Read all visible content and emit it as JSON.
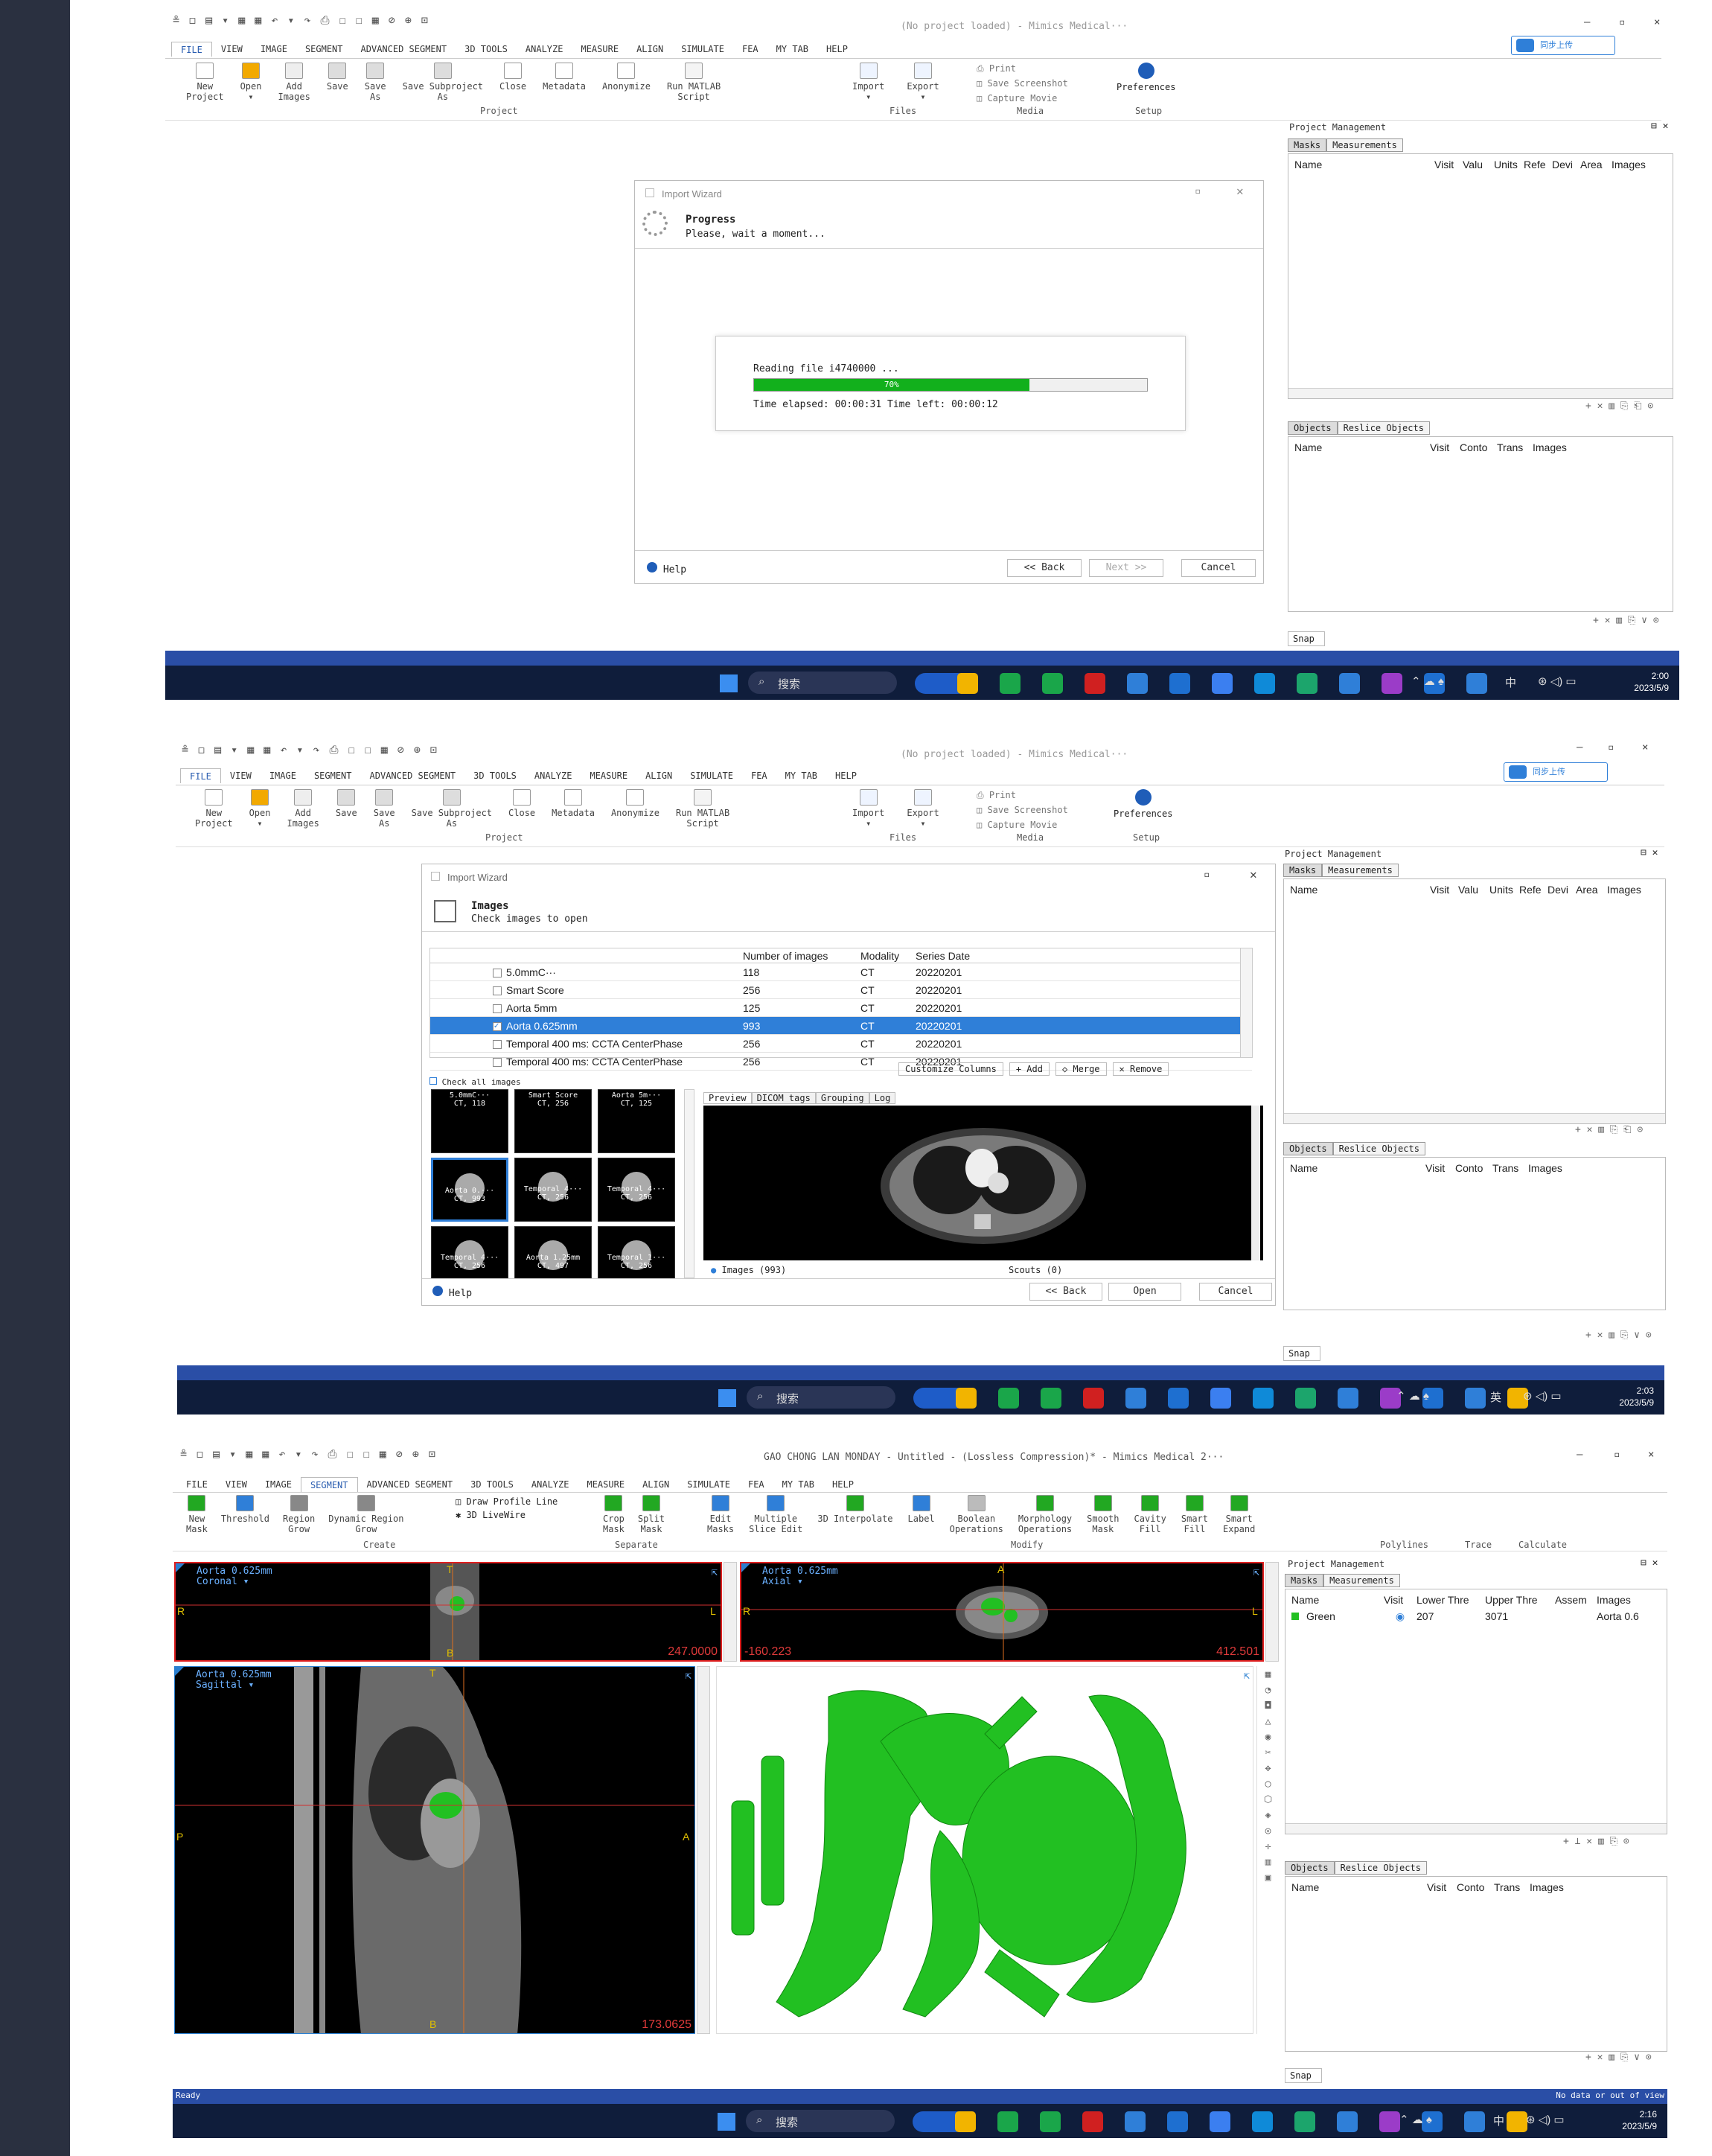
{
  "colors": {
    "accent_blue": "#2a5db0",
    "selection": "#2f7fd8",
    "progress_green": "#12b01c",
    "mask_green": "#22c022",
    "taskbar": "#0f1d3b",
    "red_border": "#e02020"
  },
  "app": {
    "quick_access": "≗ ◻ ▤ ▾ ▦ ▦ ↶ ▾ ↷ ⎙ ☐ ☐ ▦ ⊘ ⊕ ⊡",
    "title_empty": "(No project loaded) - Mimics Medical···",
    "title_3": "GAO CHONG LAN MONDAY - Untitled -  (Lossless Compression)* - Mimics Medical 2···",
    "win_controls": [
      "–",
      "▫",
      "×"
    ],
    "cloud_btn": "同步上传",
    "menu_tabs": [
      "FILE",
      "VIEW",
      "IMAGE",
      "SEGMENT",
      "ADVANCED SEGMENT",
      "3D TOOLS",
      "ANALYZE",
      "MEASURE",
      "ALIGN",
      "SIMULATE",
      "FEA",
      "MY TAB",
      "HELP"
    ],
    "file_ribbon": {
      "project": [
        {
          "l": "New\nProject",
          "icon": "new-project-icon"
        },
        {
          "l": "Open\n▾",
          "icon": "open-folder-icon"
        },
        {
          "l": "Add\nImages",
          "icon": "add-images-icon"
        },
        {
          "l": "Save",
          "icon": "save-icon"
        },
        {
          "l": "Save\nAs",
          "icon": "save-as-icon"
        },
        {
          "l": "Save Subproject\nAs",
          "icon": "save-subproject-icon"
        },
        {
          "l": "Close",
          "icon": "close-project-icon"
        },
        {
          "l": "Metadata",
          "icon": "metadata-icon"
        },
        {
          "l": "Anonymize",
          "icon": "anonymize-icon"
        },
        {
          "l": "Run MATLAB\nScript",
          "icon": "matlab-icon"
        }
      ],
      "project_label": "Project",
      "files": [
        {
          "l": "Import\n▾",
          "icon": "import-icon"
        },
        {
          "l": "Export\n▾",
          "icon": "export-icon"
        }
      ],
      "files_label": "Files",
      "media": [
        "Print",
        "Save Screenshot",
        "Capture Movie"
      ],
      "media_label": "Media",
      "prefs": "Preferences",
      "setup_label": "Setup"
    },
    "segment_ribbon": {
      "create": [
        {
          "l": "New\nMask",
          "icon": "new-mask-icon"
        },
        {
          "l": "Threshold",
          "icon": "threshold-icon"
        },
        {
          "l": "Region\nGrow",
          "icon": "region-grow-icon"
        },
        {
          "l": "Dynamic Region\nGrow",
          "icon": "dynamic-region-grow-icon"
        }
      ],
      "create_small": [
        "Draw Profile Line",
        "3D LiveWire"
      ],
      "create_label": "Create",
      "separate": [
        {
          "l": "Crop\nMask",
          "icon": "crop-mask-icon"
        },
        {
          "l": "Split\nMask",
          "icon": "split-mask-icon"
        }
      ],
      "separate_label": "Separate",
      "modify": [
        {
          "l": "Edit\nMasks",
          "icon": "edit-masks-icon"
        },
        {
          "l": "Multiple\nSlice Edit",
          "icon": "multiple-slice-edit-icon"
        },
        {
          "l": "3D Interpolate",
          "icon": "interpolate-icon"
        },
        {
          "l": "Label",
          "icon": "label-icon"
        },
        {
          "l": "Boolean\nOperations",
          "icon": "boolean-icon"
        },
        {
          "l": "Morphology\nOperations",
          "icon": "morphology-icon"
        },
        {
          "l": "Smooth\nMask",
          "icon": "smooth-mask-icon"
        },
        {
          "l": "Cavity\nFill",
          "icon": "cavity-fill-icon"
        },
        {
          "l": "Smart\nFill",
          "icon": "smart-fill-icon"
        },
        {
          "l": "Smart\nExpand",
          "icon": "smart-expand-icon"
        }
      ],
      "modify_label": "Modify",
      "polylines_label": "Polylines",
      "trace_label": "Trace",
      "calculate_label": "Calculate"
    },
    "pm": {
      "title": "Project Management",
      "tabs": [
        "Masks",
        "Measurements"
      ],
      "cols": [
        "Name",
        "Visit",
        "Valu",
        "Units",
        "Refe",
        "Devi",
        "Area",
        "Images"
      ],
      "mask_cols": [
        "Name",
        "Visit",
        "Lower Thre",
        "Upper Thre",
        "Assem",
        "Images"
      ],
      "mask_row": {
        "name": "Green",
        "eye": "◉",
        "lower": "207",
        "upper": "3071",
        "image": "Aorta 0.6"
      },
      "toolbar": "+ ✕ ▥ ⎘ ⎗ ⊙",
      "toolbar2": "+ ⊥ ✕ ▥ ⎘ ⊙"
    },
    "objects": {
      "tabs": [
        "Objects",
        "Reslice Objects"
      ],
      "cols": [
        "Name",
        "Visit",
        "Conto",
        "Trans",
        "Images"
      ],
      "toolbar": "+ ✕ ▥ ⎘ ∨ ⊙"
    },
    "snap": "Snap",
    "status_ready": "Ready",
    "status_right": "No data or out of view"
  },
  "shot1": {
    "wizard": {
      "title": "Import Wizard",
      "heading": "Progress",
      "sub": "Please, wait a moment...",
      "reading": "Reading file i4740000 ...",
      "pct": "70%",
      "progress": 0.7,
      "time": "Time elapsed: 00:00:31 Time left: 00:00:12",
      "help": "Help",
      "back": "<< Back",
      "next": "Next >>",
      "cancel": "Cancel"
    },
    "clock": {
      "time": "2:00",
      "date": "2023/5/9"
    }
  },
  "shot2": {
    "wizard": {
      "title": "Import Wizard",
      "heading": "Images",
      "sub": "Check images to open",
      "cols": [
        "",
        "Number of images",
        "Modality",
        "Series Date"
      ],
      "rows": [
        {
          "name": "5.0mmC···",
          "n": "118",
          "mod": "CT",
          "date": "20220201",
          "checked": false,
          "sel": false
        },
        {
          "name": "Smart Score",
          "n": "256",
          "mod": "CT",
          "date": "20220201",
          "checked": false,
          "sel": false
        },
        {
          "name": "Aorta 5mm",
          "n": "125",
          "mod": "CT",
          "date": "20220201",
          "checked": false,
          "sel": false
        },
        {
          "name": "Aorta 0.625mm",
          "n": "993",
          "mod": "CT",
          "date": "20220201",
          "checked": true,
          "sel": true
        },
        {
          "name": "Temporal 400 ms: CCTA CenterPhase",
          "n": "256",
          "mod": "CT",
          "date": "20220201",
          "checked": false,
          "sel": false
        },
        {
          "name": "Temporal 400 ms: CCTA CenterPhase",
          "n": "256",
          "mod": "CT",
          "date": "20220201",
          "checked": false,
          "sel": false
        }
      ],
      "btns": [
        "Customize Columns",
        "+ Add",
        "◇ Merge",
        "✕ Remove"
      ],
      "check_all": "Check all images",
      "thumbs": [
        {
          "t": "5.0mmC···",
          "s": "CT, 118"
        },
        {
          "t": "Smart Score",
          "s": "CT, 256"
        },
        {
          "t": "Aorta 5m···",
          "s": "CT, 125"
        },
        {
          "t": "Aorta 0.···",
          "s": "CT, 993"
        },
        {
          "t": "Temporal 4···",
          "s": "CT, 256"
        },
        {
          "t": "Temporal 4···",
          "s": "CT, 256"
        },
        {
          "t": "Temporal 4···",
          "s": "CT, 256"
        },
        {
          "t": "Aorta 1.25mm",
          "s": "CT, 497"
        },
        {
          "t": "Temporal 1···",
          "s": "CT, 256"
        }
      ],
      "preview_tabs": [
        "Preview",
        "DICOM tags",
        "Grouping",
        "Log"
      ],
      "images_count": "Images (993)",
      "scouts": "Scouts (0)",
      "help": "Help",
      "back": "<< Back",
      "open": "Open",
      "cancel": "Cancel"
    },
    "clock": {
      "time": "2:03",
      "date": "2023/5/9"
    }
  },
  "shot3": {
    "views": {
      "coronal": {
        "label": "Aorta 0.625mm\nCoronal ▾",
        "value": "247.0000",
        "ori": [
          "T",
          "R",
          "L",
          "B"
        ]
      },
      "axial": {
        "label": "Aorta 0.625mm\nAxial ▾",
        "value_left": "-160.223",
        "value_right": "412.501",
        "ori": [
          "A",
          "R",
          "L"
        ]
      },
      "sagittal": {
        "label": "Aorta 0.625mm\nSagittal ▾",
        "value": "173.0625",
        "ori": [
          "T",
          "P",
          "A",
          "B"
        ]
      }
    },
    "clock": {
      "time": "2:16",
      "date": "2023/5/9"
    }
  },
  "taskbar": {
    "search": "搜索",
    "tray_lang1": "中",
    "tray_lang2": "英"
  }
}
